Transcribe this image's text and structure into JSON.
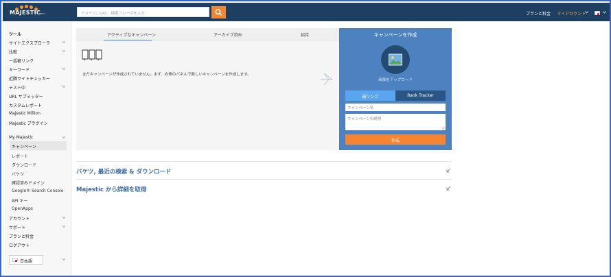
{
  "topbar": {
    "logo_text": "MAJESTIC",
    "logo_beta": "BETA",
    "search_placeholder": "ドメイン、URL、検索フレーズを入力",
    "plans_label": "プランと料金",
    "account_label": "マイアカウント",
    "brand_color": "#1d3f61",
    "accent_color": "#f58530"
  },
  "sidebar": {
    "tools_heading": "ツール",
    "items": [
      "サイトエクスプローラ",
      "比較",
      "一括被リンク",
      "キーワード",
      "近隣サイトチェッカー",
      "テスト中",
      "URL サブミッター",
      "カスタムレポート",
      "Majestic Million",
      "Majestic プラグイン"
    ],
    "my_majestic": "My Majestic",
    "sub_items": [
      "キャンペーン",
      "レポート",
      "ダウンロード",
      "バケツ",
      "確認済みドメイン",
      "Google® Search Console",
      "API キー",
      "OpenApps"
    ],
    "bottom_items": [
      "アカウント",
      "サポート",
      "プランと料金",
      "ログアウト"
    ],
    "language": "日本語"
  },
  "campaigns": {
    "tabs": [
      "アクティブなキャンペーン",
      "アーカイブ済み",
      "招待"
    ],
    "empty_message": "まだキャンペーンが作成されていません。まず、右側のパネルで新しいキャンペーンを作成します。"
  },
  "create_panel": {
    "title": "キャンペーンを作成",
    "upload_label": "画像をアップロード",
    "segment_backlinks": "被リンク",
    "segment_rank": "Rank Tracker",
    "name_placeholder": "キャンペーン名",
    "desc_placeholder": "キャンペーンの説明",
    "create_button": "作成",
    "panel_color": "#4d81c0"
  },
  "sections": {
    "buckets_title": "バケツ, 最近の検索 & ダウンロード",
    "learn_title": "Majestic から詳細を取得"
  }
}
